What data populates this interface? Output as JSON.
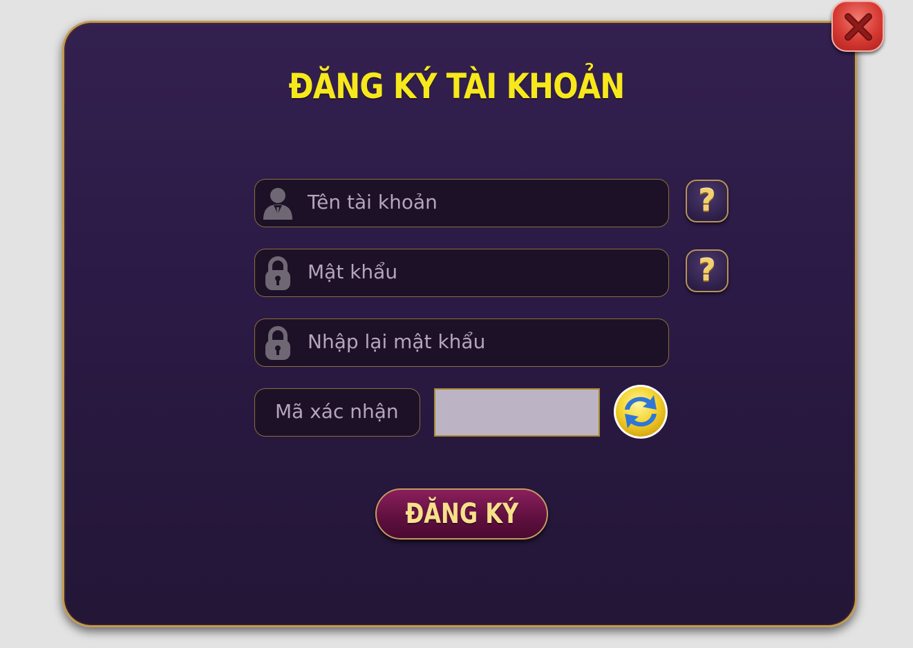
{
  "dialog": {
    "title": "ĐĂNG KÝ TÀI KHOẢN"
  },
  "form": {
    "username_placeholder": "Tên tài khoản",
    "password_placeholder": "Mật khẩu",
    "confirm_password_placeholder": "Nhập lại mật khẩu",
    "captcha_placeholder": "Mã xác nhận",
    "captcha_value": ""
  },
  "buttons": {
    "help_symbol": "?",
    "submit_label": "ĐĂNG KÝ"
  },
  "icons": {
    "close": "close-icon",
    "user": "user-icon",
    "lock": "lock-icon",
    "help": "question-mark-icon",
    "refresh": "refresh-icon"
  },
  "colors": {
    "title": "#f7e81c",
    "panel": "#2b1a45",
    "border_gold": "#c59a4e",
    "submit": "#6e1548",
    "close": "#d63a33"
  }
}
